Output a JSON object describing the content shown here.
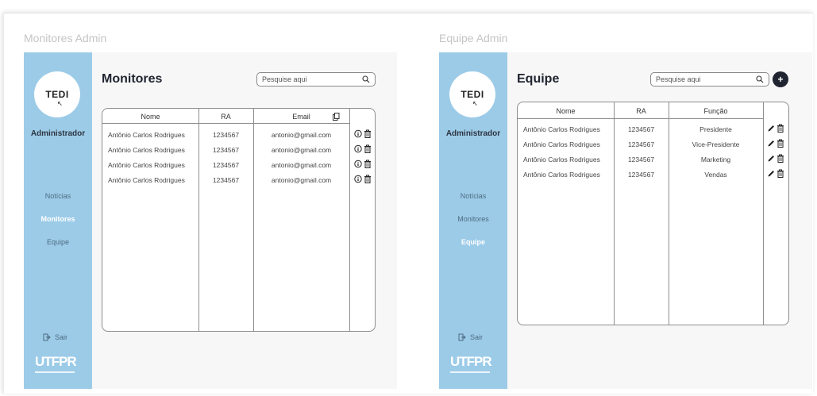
{
  "left_board": {
    "board_title": "Monitores Admin",
    "sidebar": {
      "logo_text": "TEDI",
      "role": "Administrador",
      "nav": [
        {
          "label": "Notícias",
          "active": false
        },
        {
          "label": "Monitores",
          "active": true
        },
        {
          "label": "Equipe",
          "active": false
        }
      ],
      "logout": "Sair",
      "brand": "UTFPR"
    },
    "page_title": "Monitores",
    "search_placeholder": "Pesquise aqui",
    "table": {
      "columns": [
        "Nome",
        "RA",
        "Email"
      ],
      "rows": [
        [
          "Antônio Carlos Rodrigues",
          "1234567",
          "antonio@gmail.com"
        ],
        [
          "Antônio Carlos Rodrigues",
          "1234567",
          "antonio@gmail.com"
        ],
        [
          "Antônio Carlos Rodrigues",
          "1234567",
          "antonio@gmail.com"
        ],
        [
          "Antônio Carlos Rodrigues",
          "1234567",
          "antonio@gmail.com"
        ]
      ]
    }
  },
  "right_board": {
    "board_title": "Equipe Admin",
    "sidebar": {
      "logo_text": "TEDI",
      "role": "Administrador",
      "nav": [
        {
          "label": "Notícias",
          "active": false
        },
        {
          "label": "Monitores",
          "active": false
        },
        {
          "label": "Equipe",
          "active": true
        }
      ],
      "logout": "Sair",
      "brand": "UTFPR"
    },
    "page_title": "Equipe",
    "search_placeholder": "Pesquise aqui",
    "add_label": "+",
    "table": {
      "columns": [
        "Nome",
        "RA",
        "Função"
      ],
      "rows": [
        [
          "Antônio Carlos Rodrigues",
          "1234567",
          "Presidente"
        ],
        [
          "Antônio Carlos Rodrigues",
          "1234567",
          "Vice-Presidente"
        ],
        [
          "Antônio Carlos Rodrigues",
          "1234567",
          "Marketing"
        ],
        [
          "Antônio Carlos Rodrigues",
          "1234567",
          "Vendas"
        ]
      ]
    }
  },
  "colors": {
    "sidebar": "#9ccbe8",
    "title": "#1f2430",
    "active_nav": "#ffffff"
  },
  "icons": {
    "monitor_actions": [
      "info-icon",
      "trash-icon"
    ],
    "team_actions": [
      "pencil-icon",
      "trash-icon"
    ],
    "email_header": "copy-icon",
    "search": "search-icon",
    "logout": "logout-icon"
  }
}
